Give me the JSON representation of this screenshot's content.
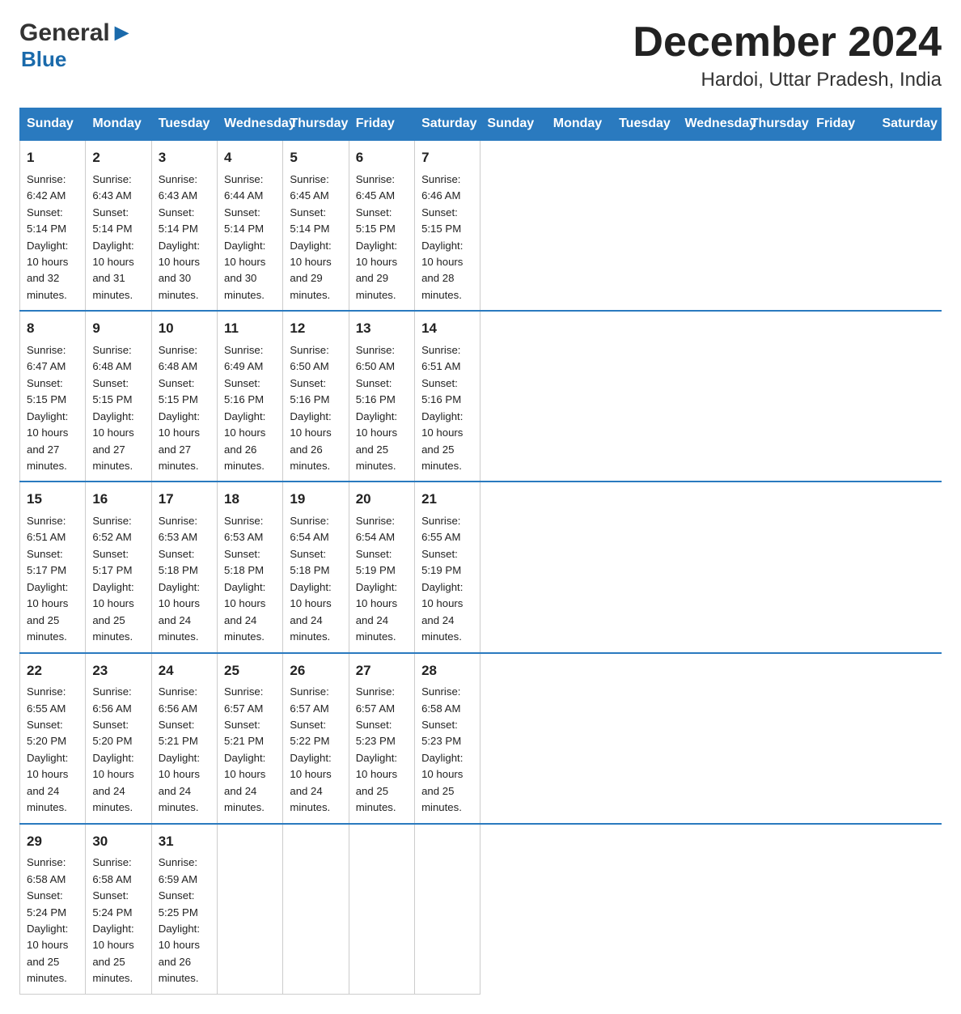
{
  "header": {
    "logo_general": "General",
    "logo_blue": "Blue",
    "month_title": "December 2024",
    "location": "Hardoi, Uttar Pradesh, India"
  },
  "days_of_week": [
    "Sunday",
    "Monday",
    "Tuesday",
    "Wednesday",
    "Thursday",
    "Friday",
    "Saturday"
  ],
  "weeks": [
    [
      {
        "day": "1",
        "sunrise": "6:42 AM",
        "sunset": "5:14 PM",
        "daylight": "10 hours and 32 minutes."
      },
      {
        "day": "2",
        "sunrise": "6:43 AM",
        "sunset": "5:14 PM",
        "daylight": "10 hours and 31 minutes."
      },
      {
        "day": "3",
        "sunrise": "6:43 AM",
        "sunset": "5:14 PM",
        "daylight": "10 hours and 30 minutes."
      },
      {
        "day": "4",
        "sunrise": "6:44 AM",
        "sunset": "5:14 PM",
        "daylight": "10 hours and 30 minutes."
      },
      {
        "day": "5",
        "sunrise": "6:45 AM",
        "sunset": "5:14 PM",
        "daylight": "10 hours and 29 minutes."
      },
      {
        "day": "6",
        "sunrise": "6:45 AM",
        "sunset": "5:15 PM",
        "daylight": "10 hours and 29 minutes."
      },
      {
        "day": "7",
        "sunrise": "6:46 AM",
        "sunset": "5:15 PM",
        "daylight": "10 hours and 28 minutes."
      }
    ],
    [
      {
        "day": "8",
        "sunrise": "6:47 AM",
        "sunset": "5:15 PM",
        "daylight": "10 hours and 27 minutes."
      },
      {
        "day": "9",
        "sunrise": "6:48 AM",
        "sunset": "5:15 PM",
        "daylight": "10 hours and 27 minutes."
      },
      {
        "day": "10",
        "sunrise": "6:48 AM",
        "sunset": "5:15 PM",
        "daylight": "10 hours and 27 minutes."
      },
      {
        "day": "11",
        "sunrise": "6:49 AM",
        "sunset": "5:16 PM",
        "daylight": "10 hours and 26 minutes."
      },
      {
        "day": "12",
        "sunrise": "6:50 AM",
        "sunset": "5:16 PM",
        "daylight": "10 hours and 26 minutes."
      },
      {
        "day": "13",
        "sunrise": "6:50 AM",
        "sunset": "5:16 PM",
        "daylight": "10 hours and 25 minutes."
      },
      {
        "day": "14",
        "sunrise": "6:51 AM",
        "sunset": "5:16 PM",
        "daylight": "10 hours and 25 minutes."
      }
    ],
    [
      {
        "day": "15",
        "sunrise": "6:51 AM",
        "sunset": "5:17 PM",
        "daylight": "10 hours and 25 minutes."
      },
      {
        "day": "16",
        "sunrise": "6:52 AM",
        "sunset": "5:17 PM",
        "daylight": "10 hours and 25 minutes."
      },
      {
        "day": "17",
        "sunrise": "6:53 AM",
        "sunset": "5:18 PM",
        "daylight": "10 hours and 24 minutes."
      },
      {
        "day": "18",
        "sunrise": "6:53 AM",
        "sunset": "5:18 PM",
        "daylight": "10 hours and 24 minutes."
      },
      {
        "day": "19",
        "sunrise": "6:54 AM",
        "sunset": "5:18 PM",
        "daylight": "10 hours and 24 minutes."
      },
      {
        "day": "20",
        "sunrise": "6:54 AM",
        "sunset": "5:19 PM",
        "daylight": "10 hours and 24 minutes."
      },
      {
        "day": "21",
        "sunrise": "6:55 AM",
        "sunset": "5:19 PM",
        "daylight": "10 hours and 24 minutes."
      }
    ],
    [
      {
        "day": "22",
        "sunrise": "6:55 AM",
        "sunset": "5:20 PM",
        "daylight": "10 hours and 24 minutes."
      },
      {
        "day": "23",
        "sunrise": "6:56 AM",
        "sunset": "5:20 PM",
        "daylight": "10 hours and 24 minutes."
      },
      {
        "day": "24",
        "sunrise": "6:56 AM",
        "sunset": "5:21 PM",
        "daylight": "10 hours and 24 minutes."
      },
      {
        "day": "25",
        "sunrise": "6:57 AM",
        "sunset": "5:21 PM",
        "daylight": "10 hours and 24 minutes."
      },
      {
        "day": "26",
        "sunrise": "6:57 AM",
        "sunset": "5:22 PM",
        "daylight": "10 hours and 24 minutes."
      },
      {
        "day": "27",
        "sunrise": "6:57 AM",
        "sunset": "5:23 PM",
        "daylight": "10 hours and 25 minutes."
      },
      {
        "day": "28",
        "sunrise": "6:58 AM",
        "sunset": "5:23 PM",
        "daylight": "10 hours and 25 minutes."
      }
    ],
    [
      {
        "day": "29",
        "sunrise": "6:58 AM",
        "sunset": "5:24 PM",
        "daylight": "10 hours and 25 minutes."
      },
      {
        "day": "30",
        "sunrise": "6:58 AM",
        "sunset": "5:24 PM",
        "daylight": "10 hours and 25 minutes."
      },
      {
        "day": "31",
        "sunrise": "6:59 AM",
        "sunset": "5:25 PM",
        "daylight": "10 hours and 26 minutes."
      },
      null,
      null,
      null,
      null
    ]
  ]
}
